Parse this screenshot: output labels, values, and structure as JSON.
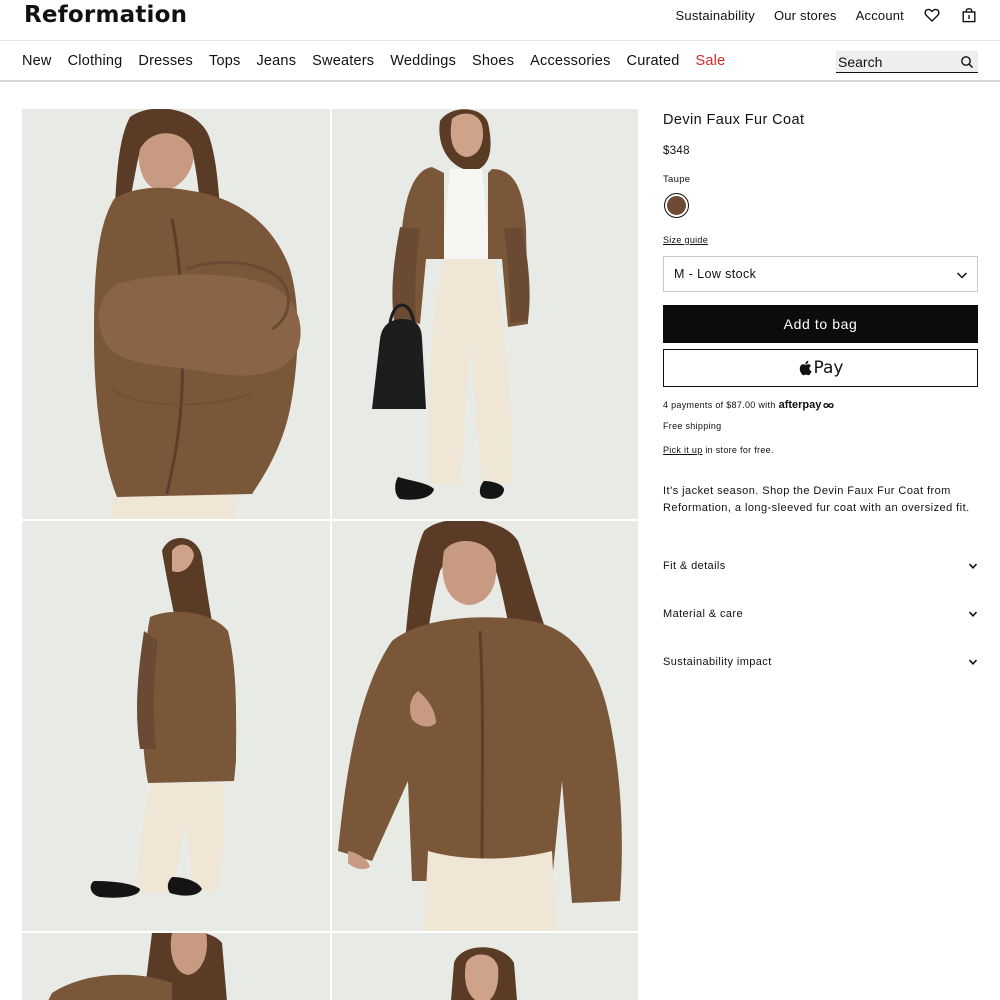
{
  "brand": "Reformation",
  "utility_nav": {
    "sustainability": "Sustainability",
    "stores": "Our stores",
    "account": "Account"
  },
  "nav": {
    "items": [
      "New",
      "Clothing",
      "Dresses",
      "Tops",
      "Jeans",
      "Sweaters",
      "Weddings",
      "Shoes",
      "Accessories",
      "Curated"
    ],
    "sale": "Sale",
    "sale_color": "#d52b2b"
  },
  "search": {
    "placeholder": "Search"
  },
  "product": {
    "title": "Devin Faux Fur Coat",
    "price": "$348",
    "color_name": "Taupe",
    "swatch_color": "#6e4a33",
    "size_guide": "Size guide",
    "selected_size": "M - Low stock",
    "add_to_bag": "Add to bag",
    "apple_pay": "Pay",
    "afterpay_text": "4 payments of $87.00 with",
    "afterpay_brand": "afterpay",
    "shipping": "Free shipping",
    "pickup_link": "Pick it up",
    "pickup_rest": "in store for free.",
    "description": "It’s jacket season. Shop the Devin Faux Fur Coat from Reformation, a long-sleeved fur coat with an oversized fit."
  },
  "accordions": [
    "Fit & details",
    "Material & care",
    "Sustainability impact"
  ],
  "gallery": {
    "photos": [
      "coat-front-arms-crossed",
      "coat-full-length-with-bag",
      "coat-back-view",
      "coat-front-closeup",
      "coat-detail-1",
      "coat-detail-2"
    ]
  },
  "colors": {
    "coat": "#7a5638",
    "trousers": "#efe6d6",
    "background": "#e9ebe7"
  }
}
